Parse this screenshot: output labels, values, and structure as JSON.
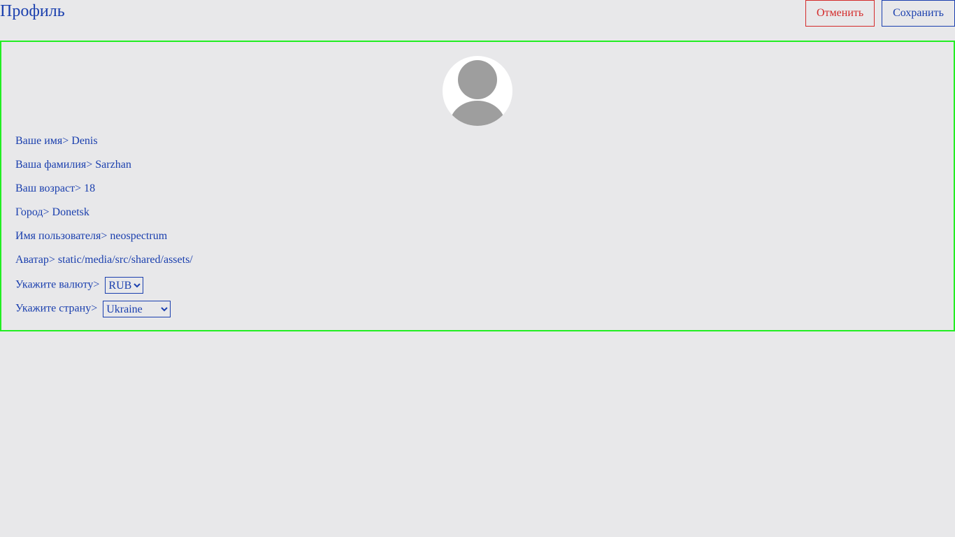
{
  "header": {
    "title": "Профиль",
    "cancel_label": "Отменить",
    "save_label": "Сохранить"
  },
  "profile": {
    "first_name": {
      "label": "Ваше имя>",
      "value": "Denis"
    },
    "last_name": {
      "label": "Ваша фамилия>",
      "value": "Sarzhan"
    },
    "age": {
      "label": "Ваш возраст>",
      "value": "18"
    },
    "city": {
      "label": "Город>",
      "value": "Donetsk"
    },
    "username": {
      "label": "Имя пользователя>",
      "value": "neospectrum"
    },
    "avatar_path": {
      "label": "Аватар>",
      "value": "static/media/src/shared/assets/"
    },
    "currency": {
      "label": "Укажите валюту>",
      "selected": "RUB"
    },
    "country": {
      "label": "Укажите страну>",
      "selected": "Ukraine"
    }
  },
  "colors": {
    "text": "#1a3fae",
    "cancel": "#d42a2a",
    "card_border": "#22ee22",
    "background": "#e8e8ea",
    "avatar_icon": "#9e9e9e"
  },
  "icons": {
    "avatar": "user-avatar-icon"
  }
}
